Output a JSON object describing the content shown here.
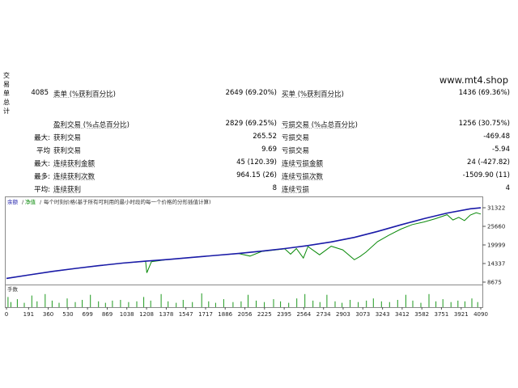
{
  "sidebar": {
    "chars": [
      "交",
      "易",
      "单",
      "总",
      "计"
    ]
  },
  "brand": "www.mt4.shop",
  "stats": {
    "total_trades": "4085",
    "short_label": "卖单 (%获利百分比)",
    "short_value": "2649 (69.20%)",
    "long_label": "买单 (%获利百分比)",
    "long_value": "1436 (69.36%)",
    "profit_trades_label": "盈利交易 (%占总百分比)",
    "profit_trades_value": "2829 (69.25%)",
    "loss_trades_label": "亏损交易 (%占总百分比)",
    "loss_trades_value": "1256 (30.75%)",
    "max_prefix": "最大:",
    "largest_profit_label": "获利交易",
    "largest_profit_value": "265.52",
    "largest_loss_label": "亏损交易",
    "largest_loss_value": "-469.48",
    "avg_prefix": "平均",
    "avg_profit_label": "获利交易",
    "avg_profit_value": "9.69",
    "avg_loss_label": "亏损交易",
    "avg_loss_value": "-5.94",
    "max2_prefix": "最大:",
    "max_consec_wins_label": "连续获利金额",
    "max_consec_wins_value": "45 (120.39)",
    "max_consec_losses_label": "连续亏损金额",
    "max_consec_losses_value": "24 (-427.82)",
    "most_prefix": "最多:",
    "max_consec_profit_label": "连续获利次数",
    "max_consec_profit_value": "964.15 (26)",
    "max_consec_loss_label": "连续亏损次数",
    "max_consec_loss_value": "-1509.90 (11)",
    "avg2_prefix": "平均:",
    "avg_consec_wins_label": "连续获利",
    "avg_consec_wins_value": "8",
    "avg_consec_losses_label": "连续亏损",
    "avg_consec_losses_value": "4"
  },
  "chart_data": {
    "type": "line",
    "legend": [
      "余额",
      "净值",
      "每个时刻价格(基于所有可利用的最小时段的每一个价格的分形插值计算)"
    ],
    "xlabel": "",
    "ylabel": "",
    "x_ticks": [
      0,
      191,
      360,
      530,
      699,
      869,
      1038,
      1208,
      1378,
      1547,
      1717,
      1886,
      2056,
      2225,
      2395,
      2564,
      2734,
      2903,
      3073,
      3243,
      3412,
      3582,
      3751,
      3921,
      4090
    ],
    "y_ticks": [
      31322,
      25660,
      19999,
      14337,
      8675
    ],
    "ylim": [
      8675,
      31322
    ],
    "colors": {
      "balance": "#1a1aa8",
      "equity": "#0a8a0a",
      "lots": "#1e9a1e"
    },
    "lots_label": "手数",
    "series": [
      {
        "name": "余额",
        "x": [
          0,
          200,
          400,
          600,
          800,
          1000,
          1200,
          1400,
          1600,
          1800,
          2000,
          2200,
          2400,
          2600,
          2800,
          3000,
          3200,
          3400,
          3600,
          3800,
          4000,
          4090
        ],
        "values": [
          9800,
          10900,
          11950,
          12850,
          13700,
          14450,
          15050,
          15600,
          16200,
          16800,
          17400,
          18100,
          18900,
          19800,
          20900,
          22300,
          24100,
          26100,
          28000,
          29700,
          31000,
          31300
        ]
      },
      {
        "name": "净值",
        "x": [
          0,
          200,
          400,
          600,
          800,
          1000,
          1200,
          1210,
          1250,
          1400,
          1600,
          1800,
          2000,
          2100,
          2200,
          2400,
          2450,
          2500,
          2560,
          2600,
          2700,
          2800,
          2900,
          3000,
          3050,
          3100,
          3200,
          3300,
          3400,
          3500,
          3600,
          3700,
          3800,
          3850,
          3900,
          3950,
          4000,
          4050,
          4090
        ],
        "values": [
          9800,
          10900,
          11950,
          12850,
          13700,
          14450,
          15000,
          11500,
          14900,
          15600,
          16200,
          16800,
          17400,
          16600,
          18000,
          18800,
          17200,
          18900,
          16000,
          19500,
          17000,
          19600,
          18500,
          15500,
          16500,
          17800,
          21000,
          23000,
          24800,
          26200,
          27000,
          28000,
          29200,
          27600,
          28400,
          27400,
          29100,
          29800,
          29400
        ]
      }
    ],
    "lots_bars": [
      {
        "x": 10,
        "v": 0.7
      },
      {
        "x": 35,
        "v": 0.35
      },
      {
        "x": 90,
        "v": 0.55
      },
      {
        "x": 150,
        "v": 0.3
      },
      {
        "x": 215,
        "v": 0.8
      },
      {
        "x": 260,
        "v": 0.4
      },
      {
        "x": 330,
        "v": 0.9
      },
      {
        "x": 390,
        "v": 0.45
      },
      {
        "x": 450,
        "v": 0.3
      },
      {
        "x": 520,
        "v": 0.6
      },
      {
        "x": 590,
        "v": 0.35
      },
      {
        "x": 650,
        "v": 0.5
      },
      {
        "x": 720,
        "v": 0.85
      },
      {
        "x": 790,
        "v": 0.4
      },
      {
        "x": 850,
        "v": 0.3
      },
      {
        "x": 910,
        "v": 0.45
      },
      {
        "x": 980,
        "v": 0.5
      },
      {
        "x": 1050,
        "v": 0.35
      },
      {
        "x": 1120,
        "v": 0.4
      },
      {
        "x": 1180,
        "v": 0.7
      },
      {
        "x": 1240,
        "v": 0.45
      },
      {
        "x": 1330,
        "v": 0.9
      },
      {
        "x": 1390,
        "v": 0.4
      },
      {
        "x": 1460,
        "v": 0.3
      },
      {
        "x": 1520,
        "v": 0.5
      },
      {
        "x": 1600,
        "v": 0.35
      },
      {
        "x": 1680,
        "v": 0.95
      },
      {
        "x": 1740,
        "v": 0.4
      },
      {
        "x": 1800,
        "v": 0.3
      },
      {
        "x": 1870,
        "v": 0.55
      },
      {
        "x": 1950,
        "v": 0.35
      },
      {
        "x": 2020,
        "v": 0.4
      },
      {
        "x": 2080,
        "v": 0.85
      },
      {
        "x": 2150,
        "v": 0.45
      },
      {
        "x": 2220,
        "v": 0.35
      },
      {
        "x": 2300,
        "v": 0.55
      },
      {
        "x": 2360,
        "v": 0.4
      },
      {
        "x": 2430,
        "v": 0.3
      },
      {
        "x": 2500,
        "v": 0.6
      },
      {
        "x": 2570,
        "v": 0.9
      },
      {
        "x": 2640,
        "v": 0.45
      },
      {
        "x": 2700,
        "v": 0.35
      },
      {
        "x": 2760,
        "v": 0.85
      },
      {
        "x": 2830,
        "v": 0.4
      },
      {
        "x": 2890,
        "v": 0.3
      },
      {
        "x": 2960,
        "v": 0.5
      },
      {
        "x": 3030,
        "v": 0.35
      },
      {
        "x": 3100,
        "v": 0.45
      },
      {
        "x": 3160,
        "v": 0.6
      },
      {
        "x": 3230,
        "v": 0.4
      },
      {
        "x": 3300,
        "v": 0.35
      },
      {
        "x": 3370,
        "v": 0.5
      },
      {
        "x": 3440,
        "v": 0.85
      },
      {
        "x": 3500,
        "v": 0.45
      },
      {
        "x": 3570,
        "v": 0.3
      },
      {
        "x": 3640,
        "v": 0.9
      },
      {
        "x": 3700,
        "v": 0.4
      },
      {
        "x": 3760,
        "v": 0.55
      },
      {
        "x": 3830,
        "v": 0.35
      },
      {
        "x": 3890,
        "v": 0.45
      },
      {
        "x": 3950,
        "v": 0.4
      },
      {
        "x": 4010,
        "v": 0.6
      },
      {
        "x": 4060,
        "v": 0.35
      }
    ]
  }
}
